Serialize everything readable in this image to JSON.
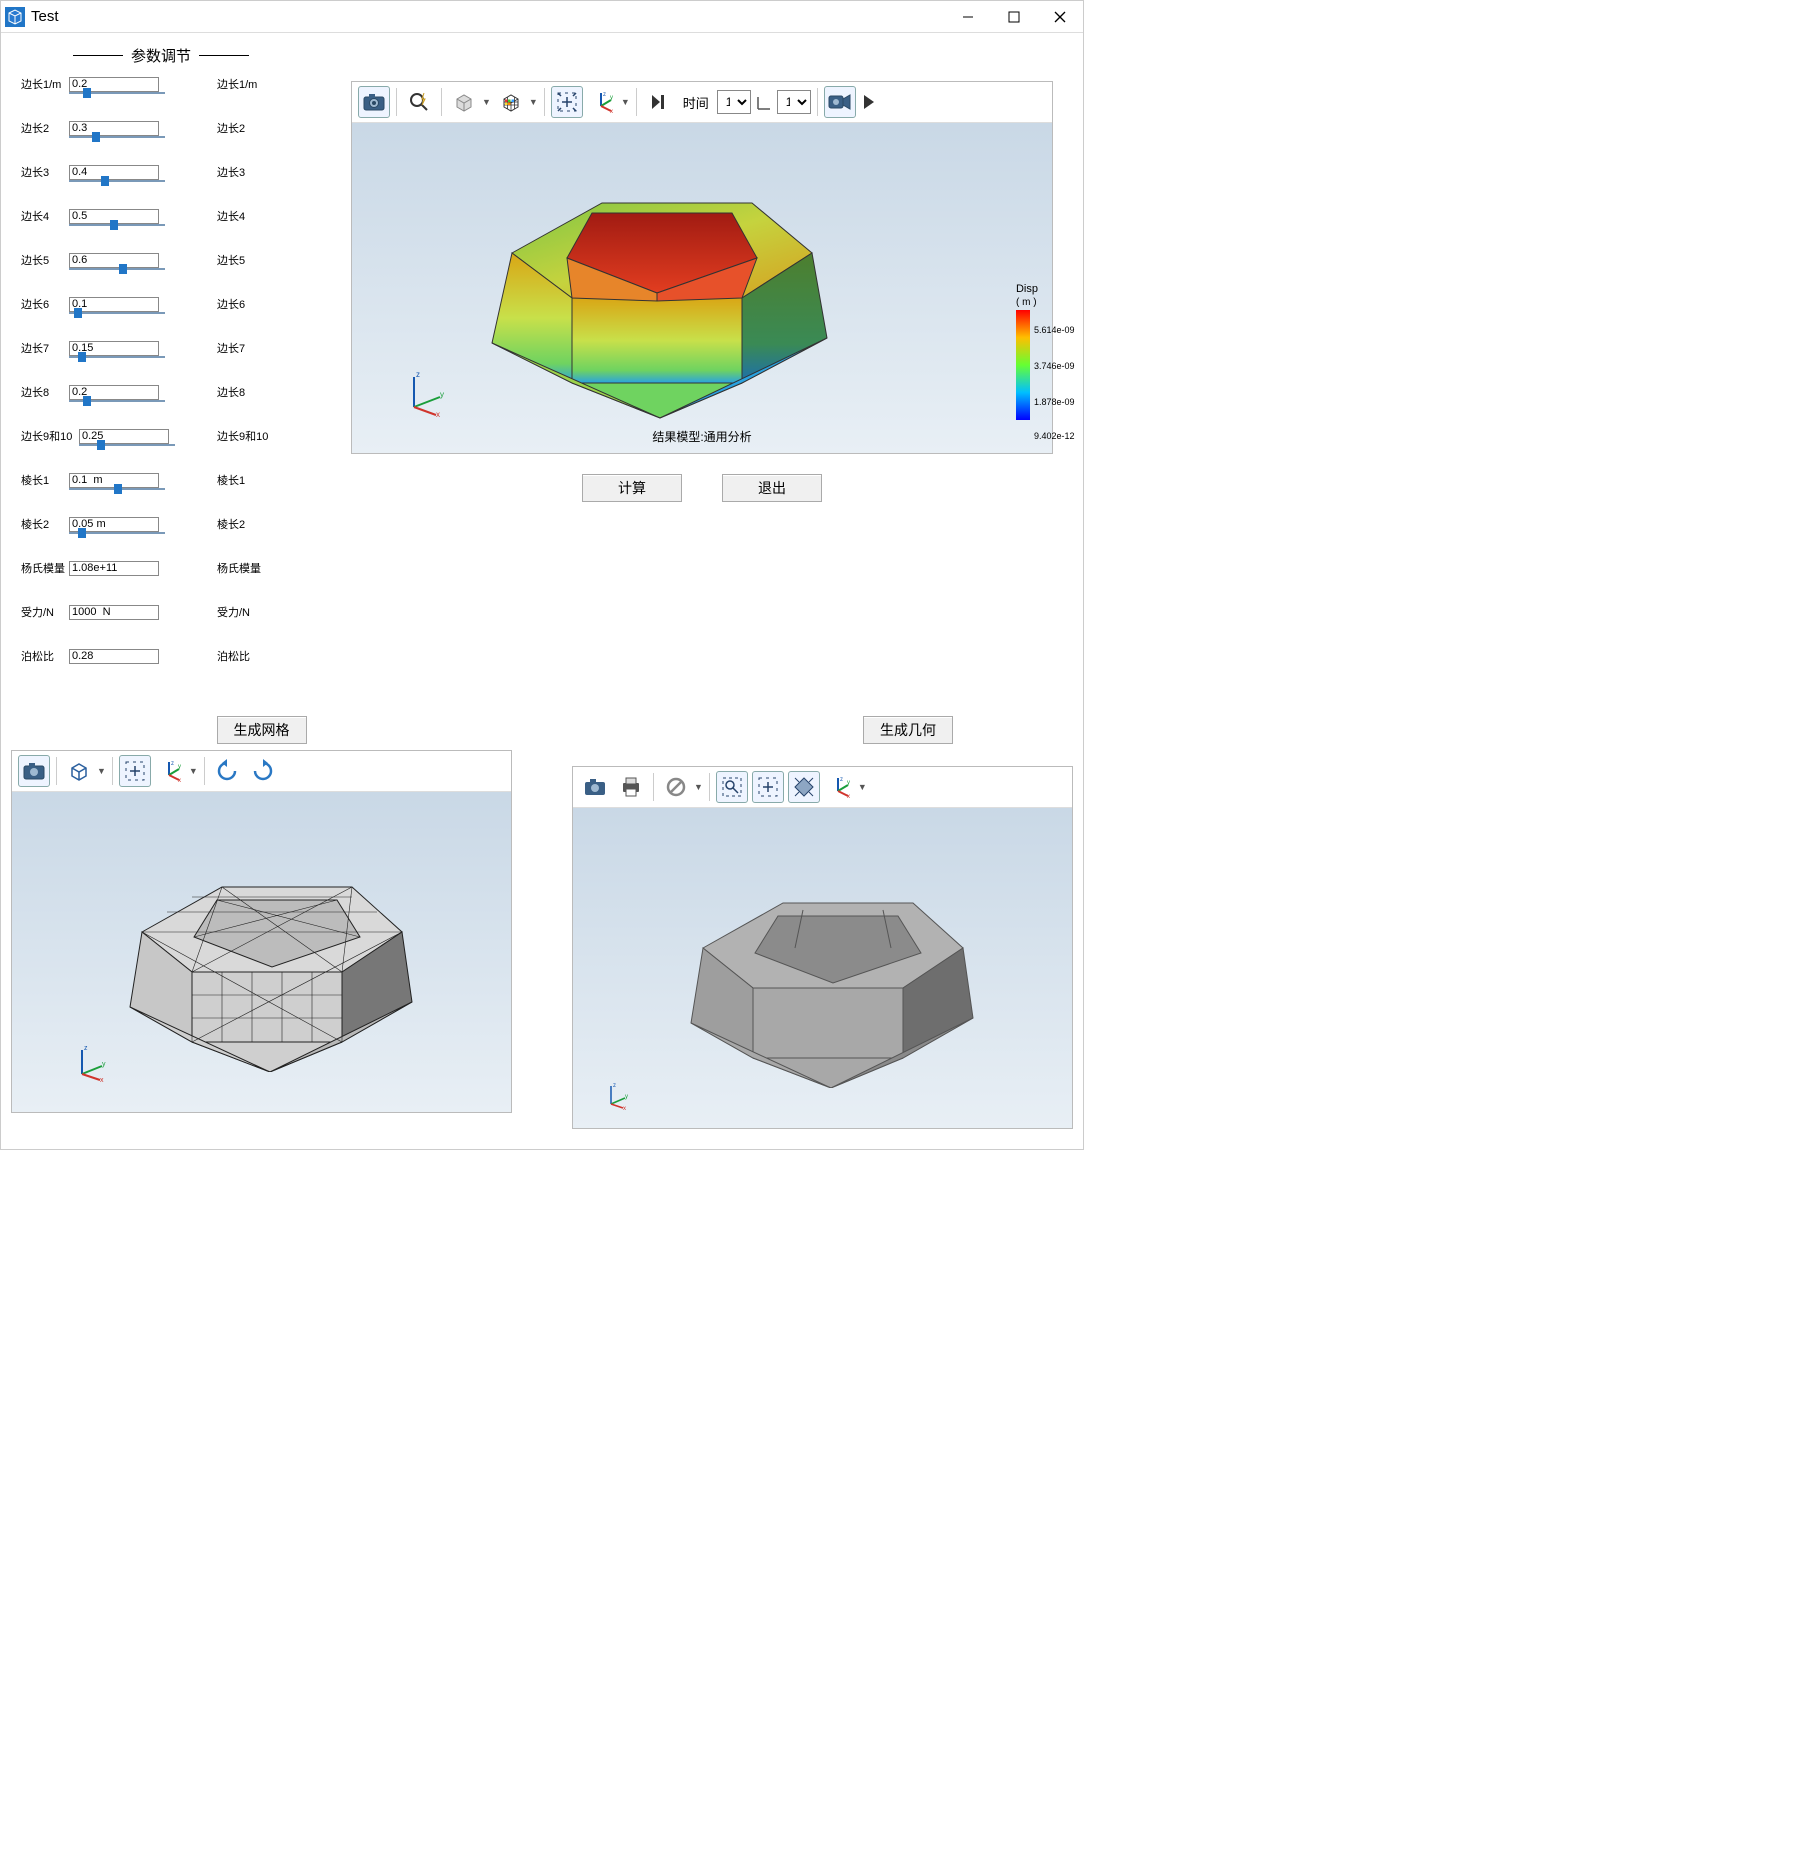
{
  "window": {
    "title": "Test"
  },
  "param_panel": {
    "header": "参数调节",
    "rows": [
      {
        "label": "边长1/m",
        "value": "0.2",
        "rlabel": "边长1/m",
        "thumb_pct": 15
      },
      {
        "label": "边长2",
        "value": "0.3",
        "rlabel": "边长2",
        "thumb_pct": 25
      },
      {
        "label": "边长3",
        "value": "0.4",
        "rlabel": "边长3",
        "thumb_pct": 35
      },
      {
        "label": "边长4",
        "value": "0.5",
        "rlabel": "边长4",
        "thumb_pct": 45
      },
      {
        "label": "边长5",
        "value": "0.6",
        "rlabel": "边长5",
        "thumb_pct": 55
      },
      {
        "label": "边长6",
        "value": "0.1",
        "rlabel": "边长6",
        "thumb_pct": 5
      },
      {
        "label": "边长7",
        "value": "0.15",
        "rlabel": "边长7",
        "thumb_pct": 10
      },
      {
        "label": "边长8",
        "value": "0.2",
        "rlabel": "边长8",
        "thumb_pct": 15
      },
      {
        "label": "边长9和10",
        "value": "0.25",
        "rlabel": "边长9和10",
        "thumb_pct": 20,
        "wide": true
      },
      {
        "label": "棱长1",
        "value": "0.1  m",
        "rlabel": "棱长1",
        "thumb_pct": 50
      },
      {
        "label": "棱长2",
        "value": "0.05 m",
        "rlabel": "棱长2",
        "thumb_pct": 10
      },
      {
        "label": "杨氏模量",
        "value": "1.08e+11",
        "rlabel": "杨氏模量",
        "thumb_pct": null
      },
      {
        "label": "受力/N",
        "value": "1000  N",
        "rlabel": "受力/N",
        "thumb_pct": null
      },
      {
        "label": "泊松比",
        "value": "0.28",
        "rlabel": "泊松比",
        "thumb_pct": null
      }
    ]
  },
  "result_viewer": {
    "toolbar": {
      "time_label": "时间",
      "select1": "1",
      "select2": "1"
    },
    "caption": "结果模型:通用分析",
    "legend": {
      "title": "Disp",
      "unit": "( m )",
      "ticks": [
        "5.614e-09",
        "3.746e-09",
        "1.878e-09",
        "9.402e-12"
      ]
    }
  },
  "buttons": {
    "calc": "计算",
    "exit": "退出",
    "gen_mesh": "生成网格",
    "gen_geom": "生成几何"
  },
  "icons": {
    "camera": "camera-icon",
    "zoom_flash": "zoom-flash-icon",
    "cube_drop": "cube-dropdown-icon",
    "rubik": "rubik-icon",
    "fit": "fit-extents-icon",
    "axes_drop": "axes-dropdown-icon",
    "skip_last": "skip-last-icon",
    "video": "video-camera-icon",
    "forward": "forward-icon",
    "box3d": "wire-cube-dropdown-icon",
    "rotate_ccw": "rotate-ccw-icon",
    "rotate_cw": "rotate-cw-icon",
    "print": "print-icon",
    "deny": "disabled-dropdown-icon",
    "zoom_rect": "zoom-rect-icon",
    "diamond": "diamond-fit-icon"
  }
}
